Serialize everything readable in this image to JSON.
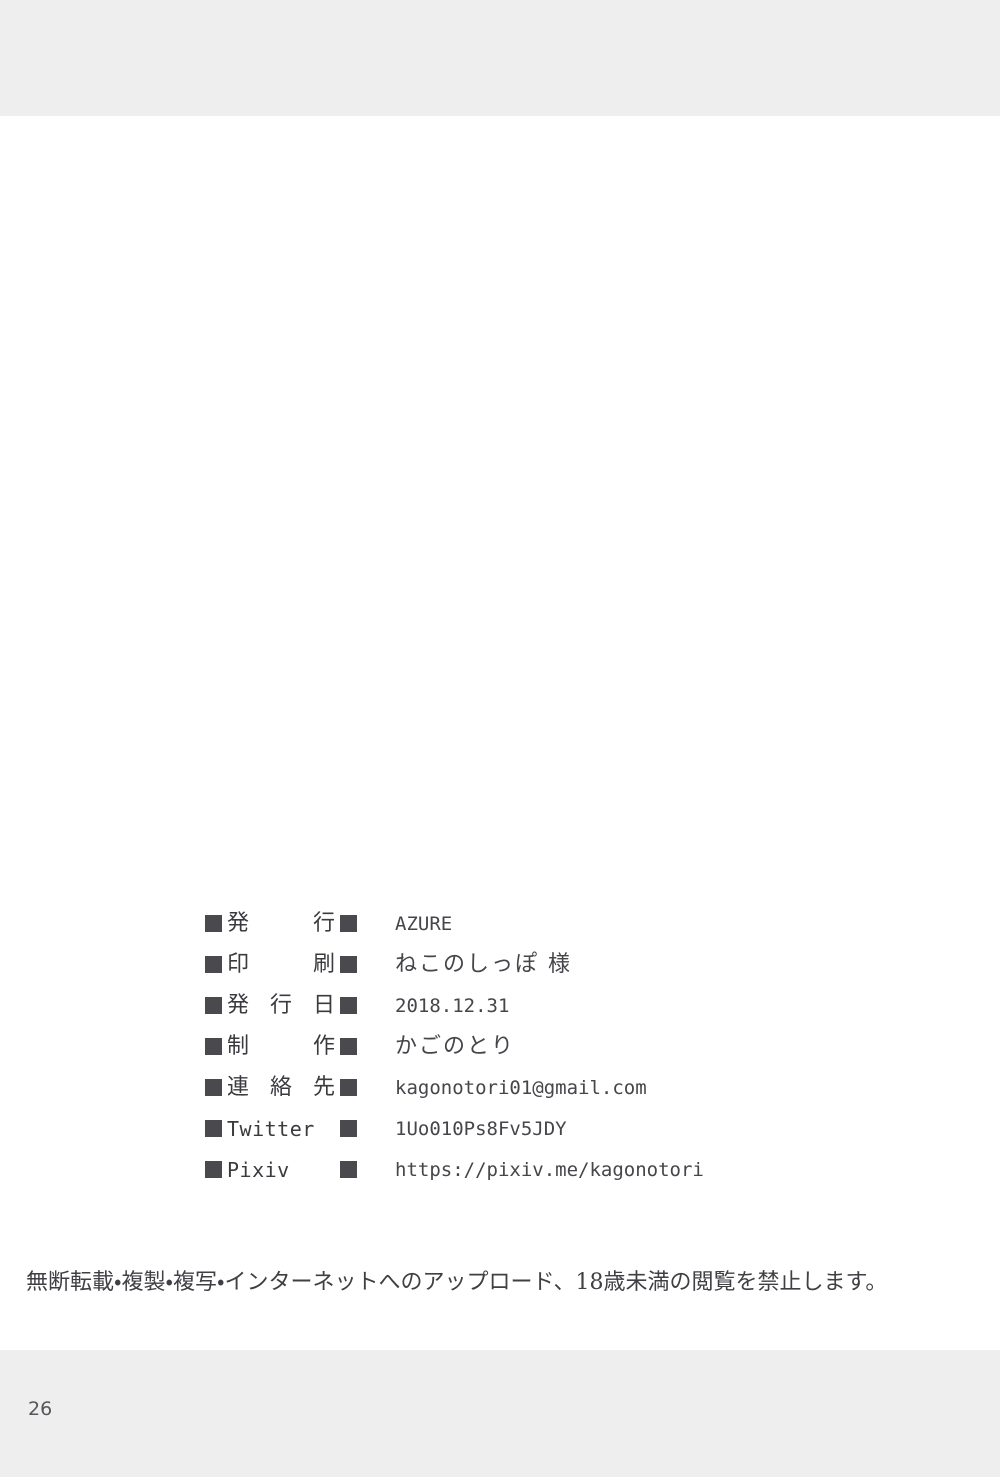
{
  "page": {
    "folio": "26",
    "background_color": "#ffffff",
    "text_color": "#45454a",
    "marker_color": "#4a4a4e"
  },
  "colophon": {
    "rows": [
      {
        "label": "発行",
        "label_kind": "jp",
        "value": "AZURE",
        "value_kind": "mono"
      },
      {
        "label": "印刷",
        "label_kind": "jp",
        "value": "ねこのしっぽ 様",
        "value_kind": "jp"
      },
      {
        "label": "発行日",
        "label_kind": "jp",
        "value": "2018.12.31",
        "value_kind": "mono"
      },
      {
        "label": "制作",
        "label_kind": "jp",
        "value": "かごのとり",
        "value_kind": "jp"
      },
      {
        "label": "連絡先",
        "label_kind": "jp",
        "value": "kagonotori01@gmail.com",
        "value_kind": "mono"
      },
      {
        "label": "Twitter",
        "label_kind": "latin",
        "value": "1Uo010Ps8Fv5JDY",
        "value_kind": "mono"
      },
      {
        "label": "Pixiv",
        "label_kind": "latin",
        "value": "https://pixiv.me/kagonotori",
        "value_kind": "mono"
      }
    ]
  },
  "notice": {
    "text": "無断転載・複製・複写・インターネットへのアップロード、18歳未満の閲覧を禁止します。"
  }
}
